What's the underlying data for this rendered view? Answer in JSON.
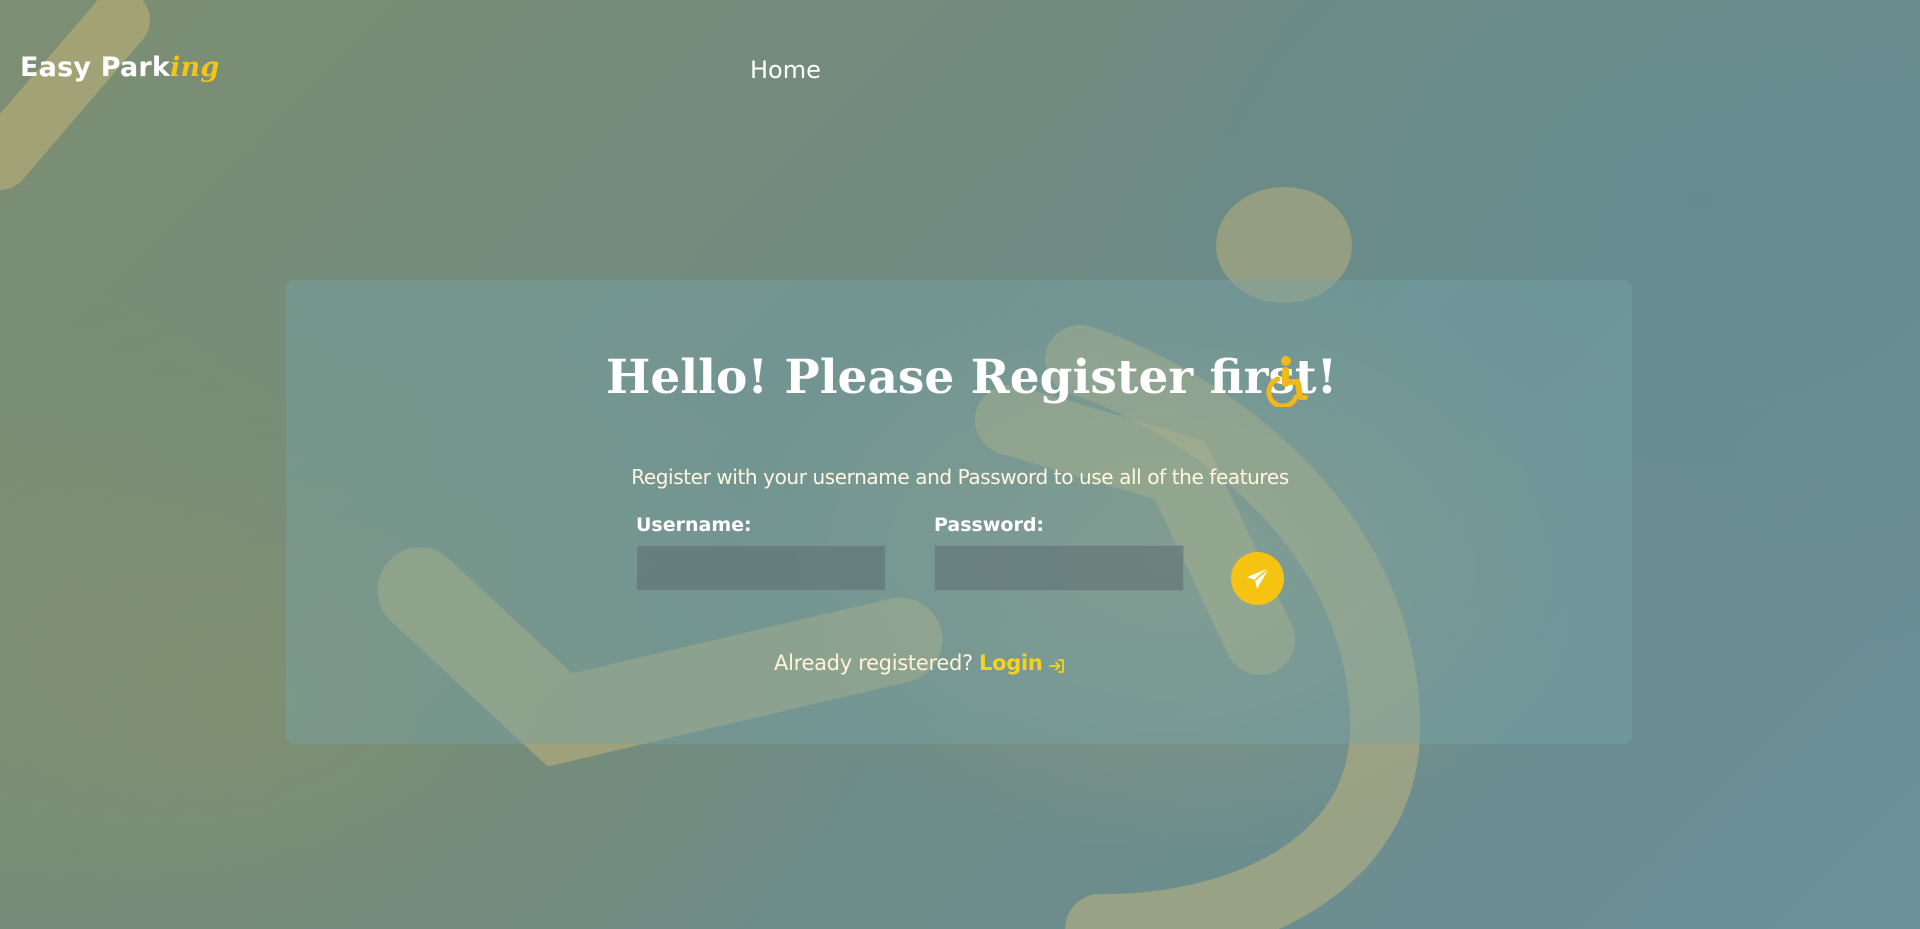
{
  "navbar": {
    "brand_main": "Easy Park",
    "brand_accent": "ing",
    "home_label": "Home"
  },
  "register": {
    "heading": "Hello! Please Register first!",
    "heading_icon": "wheelchair-icon",
    "subtitle": "Register with your username and Password to use all of the features",
    "username_label": "Username:",
    "username_value": "",
    "password_label": "Password:",
    "password_value": "",
    "submit_icon": "paper-plane-icon",
    "already_text": "Already registered?",
    "login_label": "Login",
    "login_icon": "sign-in-icon"
  },
  "colors": {
    "accent": "#f6c313",
    "text": "#ffffff"
  }
}
